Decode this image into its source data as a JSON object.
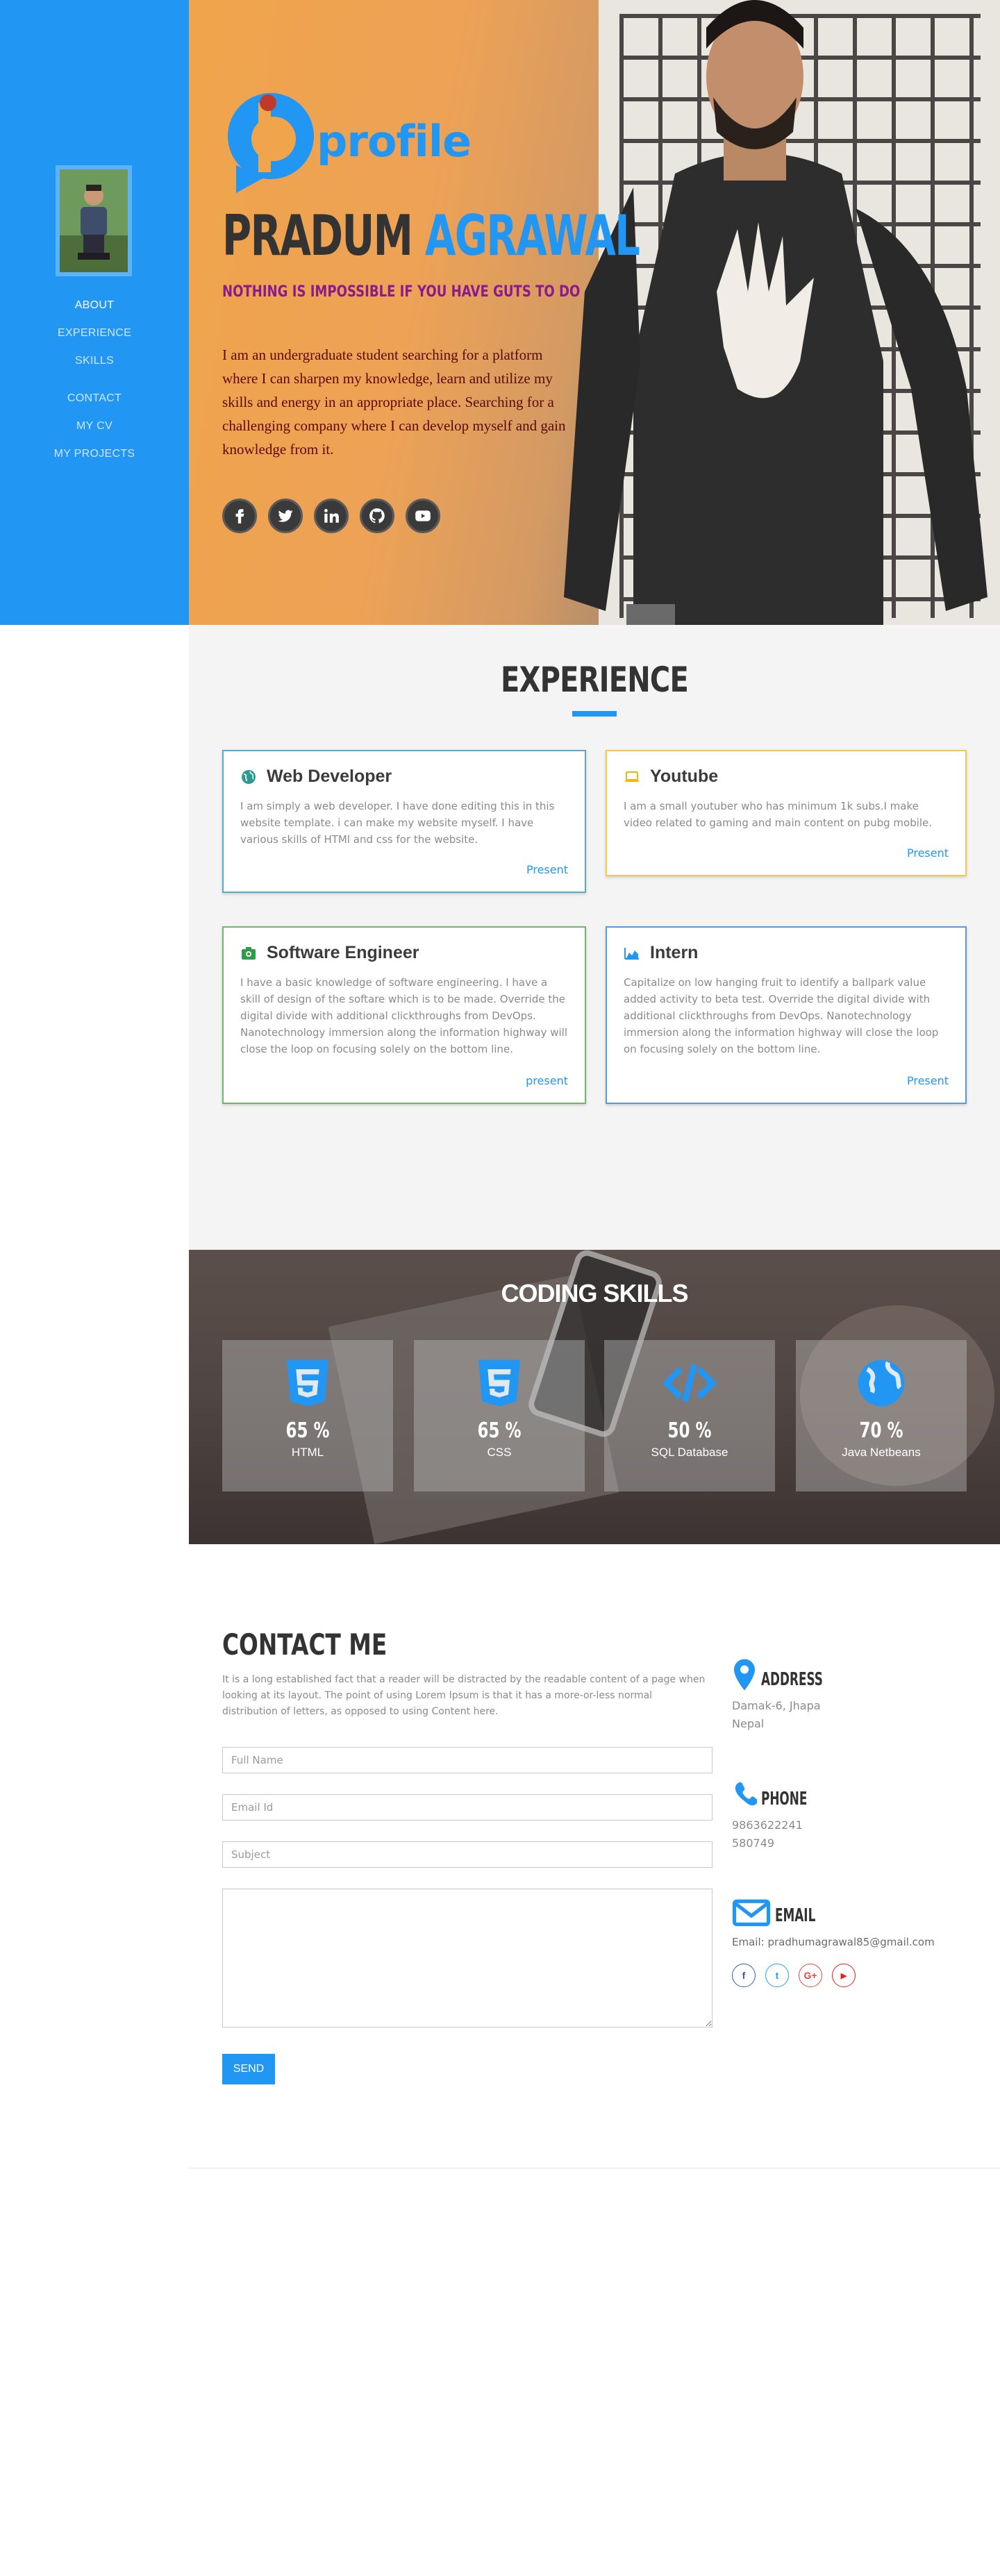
{
  "sidebar": {
    "nav": [
      {
        "label": "ABOUT"
      },
      {
        "label": "EXPERIENCE"
      },
      {
        "label": "SKILLS"
      },
      {
        "label": "CONTACT"
      },
      {
        "label": "MY CV"
      },
      {
        "label": "MY PROJECTS"
      }
    ]
  },
  "hero": {
    "logo_text": "profile",
    "first_name": "PRADUM",
    "last_name": "AGRAWAL",
    "tagline": "NOTHING IS IMPOSSIBLE IF YOU HAVE GUTS TO DO",
    "bio": "I am an undergraduate student searching for a platform where I can sharpen my knowledge, learn and utilize my skills and energy in an appropriate place. Searching for a challenging company where I can develop myself and gain knowledge from it.",
    "socials": [
      {
        "icon": "facebook-icon"
      },
      {
        "icon": "twitter-icon"
      },
      {
        "icon": "linkedin-icon"
      },
      {
        "icon": "github-icon"
      },
      {
        "icon": "youtube-icon"
      }
    ]
  },
  "experience": {
    "title": "EXPERIENCE",
    "cards": [
      {
        "icon": "globe-icon",
        "title": "Web Developer",
        "body": "I am simply a web developer. I have done editing this in this website template. i can make my website myself. I have various skills of HTMl and css for the website.",
        "date": "Present",
        "color": "#5aa9c9"
      },
      {
        "icon": "laptop-icon",
        "title": "Youtube",
        "body": "I am a small youtuber who has minimum 1k subs.I make video related to gaming and main content on pubg mobile.",
        "date": "Present",
        "color": "#f2c94c"
      },
      {
        "icon": "camera-icon",
        "title": "Software Engineer",
        "body": "I have a basic knowledge of software engineering. I have a skill of design of the softare which is to be made. Override the digital divide with additional clickthroughs from DevOps. Nanotechnology immersion along the information highway will close the loop on focusing solely on the bottom line.",
        "date": "present",
        "color": "#6fb86a"
      },
      {
        "icon": "area-chart-icon",
        "title": "Intern",
        "body": "Capitalize on low hanging fruit to identify a ballpark value added activity to beta test. Override the digital divide with additional clickthroughs from DevOps. Nanotechnology immersion along the information highway will close the loop on focusing solely on the bottom line.",
        "date": "Present",
        "color": "#5b9bd5"
      }
    ]
  },
  "skills": {
    "title": "CODING SKILLS",
    "items": [
      {
        "icon": "html5-icon",
        "percent": "65 %",
        "name": "HTML"
      },
      {
        "icon": "css3-icon",
        "percent": "65 %",
        "name": "CSS"
      },
      {
        "icon": "code-icon",
        "percent": "50 %",
        "name": "SQL Database"
      },
      {
        "icon": "globe-icon",
        "percent": "70 %",
        "name": "Java Netbeans"
      }
    ]
  },
  "contact": {
    "title": "CONTACT ME",
    "description": "It is a long established fact that a reader will be distracted by the readable content of a page when looking at its layout. The point of using Lorem Ipsum is that it has a more-or-less normal distribution of letters, as opposed to using Content here.",
    "placeholders": {
      "name": "Full Name",
      "email": "Email Id",
      "subject": "Subject",
      "message": ""
    },
    "send_label": "SEND",
    "address_label": "ADDRESS",
    "address": "Damak-6, Jhapa Nepal",
    "phone_label": "PHONE",
    "phone": "9863622241 580749",
    "email_label": "EMAIL",
    "email": "Email: pradhumagrawal85@gmail.com",
    "mini_socials": [
      {
        "icon": "facebook-icon",
        "glyph": "f",
        "color": "#3b5998"
      },
      {
        "icon": "twitter-icon",
        "glyph": "t",
        "color": "#1da1f2"
      },
      {
        "icon": "google-plus-icon",
        "glyph": "G+",
        "color": "#dd4b39"
      },
      {
        "icon": "youtube-icon",
        "glyph": "▶",
        "color": "#e62117"
      }
    ]
  },
  "colors": {
    "accent": "#2196f3",
    "sidebar": "#2196f3",
    "tagline": "#8b1a8e",
    "experience_bg": "#f4f4f4"
  }
}
